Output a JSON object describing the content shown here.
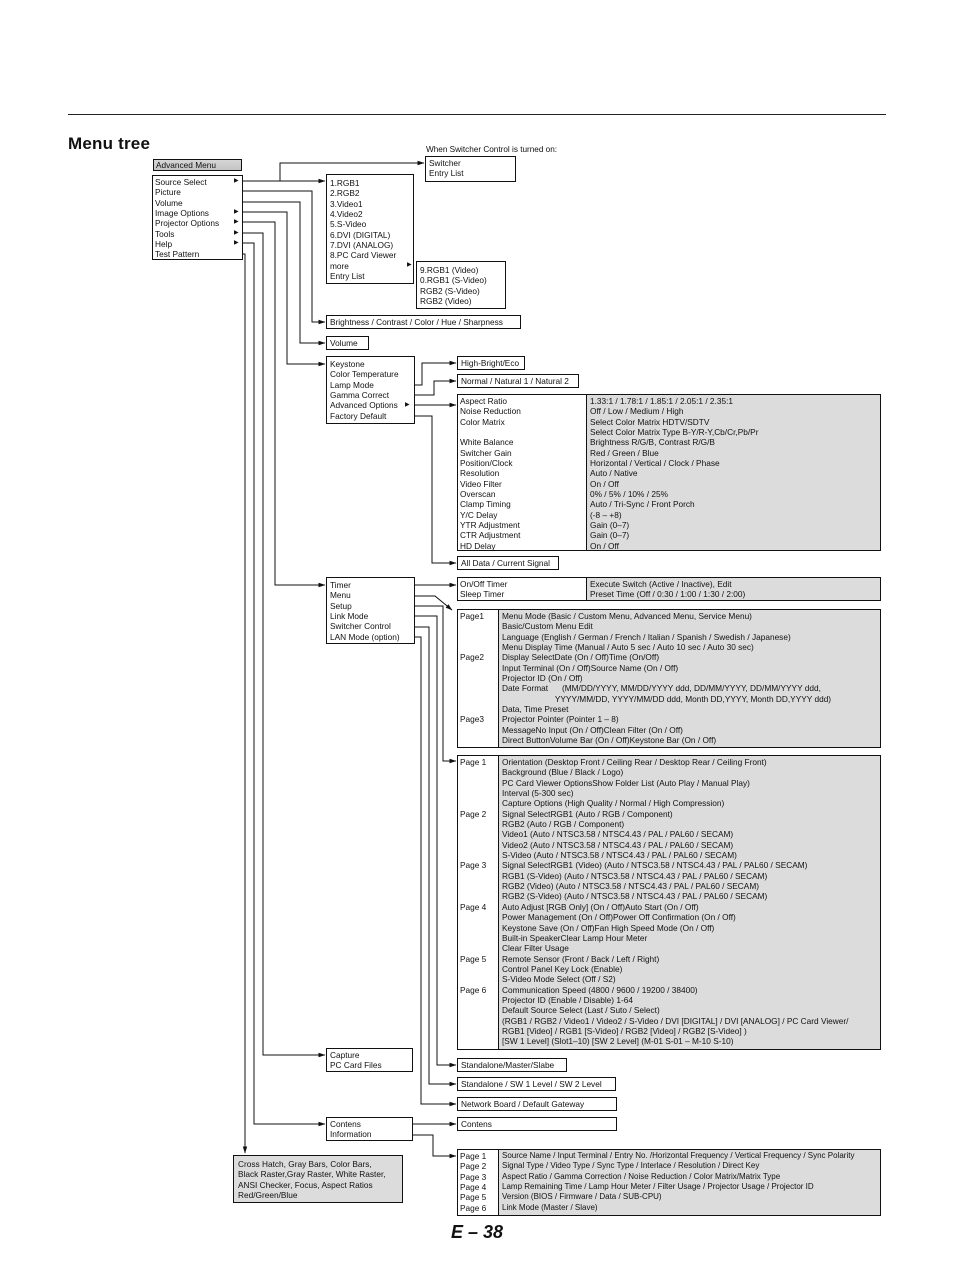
{
  "page": {
    "title": "Menu tree",
    "page_number": "E – 38"
  },
  "switcher_note": "When Switcher Control is turned on:",
  "switcher_box": [
    "Switcher",
    "Entry List"
  ],
  "advanced_menu": {
    "header": "Advanced Menu",
    "items": [
      {
        "label": "Source Select",
        "submenu": true
      },
      {
        "label": "Picture",
        "submenu": false
      },
      {
        "label": "Volume",
        "submenu": false
      },
      {
        "label": "Image Options",
        "submenu": true
      },
      {
        "label": "Projector Options",
        "submenu": true
      },
      {
        "label": "Tools",
        "submenu": true
      },
      {
        "label": "Help",
        "submenu": true
      },
      {
        "label": "Test Pattern",
        "submenu": false
      }
    ]
  },
  "source_select": [
    "1.RGB1",
    "2.RGB2",
    "3.Video1",
    "4.Video2",
    "5.S-Video",
    "6.DVI (DIGITAL)",
    "7.DVI (ANALOG)",
    "8.PC Card Viewer",
    "more",
    "Entry List"
  ],
  "source_more": [
    "9.RGB1 (Video)",
    "0.RGB1 (S-Video)",
    "RGB2 (S-Video)",
    "RGB2 (Video)"
  ],
  "picture": "Brightness / Contrast / Color / Hue / Sharpness",
  "volume": "Volume",
  "image_options": [
    "Keystone",
    "Color Temperature",
    "Lamp Mode",
    "Gamma Correct",
    "Advanced Options",
    "Factory Default"
  ],
  "lamp_mode": "High-Bright/Eco",
  "gamma_correct": "Normal / Natural 1 / Natural 2",
  "factory_default": "All Data / Current Signal",
  "advanced_options": [
    {
      "name": "Aspect Ratio",
      "value": "1.33:1 / 1.78:1 / 1.85:1 / 2.05:1 / 2.35:1"
    },
    {
      "name": "Noise Reduction",
      "value": "Off / Low / Medium / High"
    },
    {
      "name": "Color Matrix",
      "value": "Select Color Matrix HDTV/SDTV"
    },
    {
      "name": "",
      "value": "Select Color Matrix Type B-Y/R-Y,Cb/Cr,Pb/Pr"
    },
    {
      "name": "White Balance",
      "value": "Brightness R/G/B, Contrast R/G/B"
    },
    {
      "name": "Switcher Gain",
      "value": "Red / Green / Blue"
    },
    {
      "name": "Position/Clock",
      "value": "Horizontal / Vertical / Clock / Phase"
    },
    {
      "name": "Resolution",
      "value": "Auto / Native"
    },
    {
      "name": "Video Filter",
      "value": "On / Off"
    },
    {
      "name": "Overscan",
      "value": "0% / 5% / 10% / 25%"
    },
    {
      "name": "Clamp Timing",
      "value": "Auto / Tri-Sync / Front Porch"
    },
    {
      "name": "Y/C Delay",
      "value": "(-8 – +8)"
    },
    {
      "name": "YTR Adjustment",
      "value": "Gain (0–7)"
    },
    {
      "name": "CTR Adjustment",
      "value": "Gain (0–7)"
    },
    {
      "name": "HD Delay",
      "value": "On / Off"
    }
  ],
  "projector_options": [
    "Timer",
    "Menu",
    "Setup",
    "Link Mode",
    "Switcher Control",
    "LAN Mode (option)"
  ],
  "timer": [
    {
      "name": "On/Off Timer",
      "value": "Execute Switch (Active / Inactive), Edit"
    },
    {
      "name": "Sleep Timer",
      "value": "Preset Time (Off / 0:30 / 1:00 / 1:30 / 2:00)"
    }
  ],
  "menu_pages": {
    "labels": [
      "Page1",
      "",
      "",
      "",
      "Page2",
      "",
      "",
      "",
      "",
      "",
      "Page3",
      "",
      ""
    ],
    "lines": [
      "Menu Mode (Basic / Custom Menu, Advanced Menu, Service Menu)",
      "Basic/Custom Menu Edit",
      "Language (English / German / French / Italian / Spanish / Swedish / Japanese)",
      "Menu Display Time (Manual / Auto 5 sec / Auto 10 sec / Auto 30 sec)",
      [
        "Display Select",
        "Date (On / Off)",
        "Time (On/Off)"
      ],
      [
        "",
        "Input Terminal (On / Off)",
        "Source Name (On / Off)"
      ],
      [
        "",
        "Projector ID (On / Off)",
        ""
      ],
      "Date Format      (MM/DD/YYYY, MM/DD/YYYY ddd, DD/MM/YYYY, DD/MM/YYYY ddd,",
      "                       YYYY/MM/DD, YYYY/MM/DD ddd, Month DD,YYYY, Month DD,YYYY ddd)",
      "Data, Time Preset",
      "Projector Pointer (Pointer 1 – 8)",
      [
        "Message",
        "No Input (On / Off)",
        "Clean Filter (On / Off)"
      ],
      [
        "Direct Button",
        "Volume Bar (On / Off)",
        "Keystone Bar (On / Off)"
      ]
    ]
  },
  "setup_pages": {
    "labels": [
      "Page 1",
      "",
      "",
      "",
      "",
      "Page 2",
      "",
      "",
      "",
      "",
      "Page 3",
      "",
      "",
      "",
      "Page 4",
      "",
      "",
      "",
      "",
      "Page 5",
      "",
      "",
      "Page 6",
      "",
      "",
      "",
      "",
      ""
    ],
    "lines": [
      "Orientation (Desktop Front / Ceiling Rear / Desktop Rear / Ceiling Front)",
      "Background (Blue / Black / Logo)",
      [
        "PC Card Viewer Options",
        "Show Folder List (Auto Play / Manual Play)"
      ],
      [
        "",
        "Interval (5-300 sec)"
      ],
      "Capture Options (High Quality / Normal / High Compression)",
      [
        "Signal Select",
        "RGB1 (Auto / RGB / Component)"
      ],
      [
        "",
        "RGB2 (Auto / RGB / Component)"
      ],
      [
        "",
        "Video1 (Auto / NTSC3.58 / NTSC4.43 / PAL / PAL60 / SECAM)"
      ],
      [
        "",
        "Video2 (Auto / NTSC3.58 / NTSC4.43 / PAL / PAL60 / SECAM)"
      ],
      [
        "",
        "S-Video (Auto / NTSC3.58 / NTSC4.43 / PAL / PAL60 / SECAM)"
      ],
      [
        "Signal Select",
        "RGB1 (Video) (Auto / NTSC3.58 / NTSC4.43 / PAL / PAL60 / SECAM)"
      ],
      [
        "",
        "RGB1 (S-Video) (Auto / NTSC3.58 / NTSC4.43 / PAL / PAL60 / SECAM)"
      ],
      [
        "",
        "RGB2 (Video) (Auto / NTSC3.58 / NTSC4.43 / PAL / PAL60 / SECAM)"
      ],
      [
        "",
        "RGB2 (S-Video) (Auto / NTSC3.58 / NTSC4.43 / PAL / PAL60 / SECAM)"
      ],
      [
        "Auto Adjust [RGB Only] (On / Off)",
        "Auto Start (On / Off)"
      ],
      [
        "Power Management (On / Off)",
        "Power Off Confirmation (On / Off)"
      ],
      [
        "Keystone Save (On / Off)",
        "Fan High Speed Mode (On / Off)"
      ],
      [
        "Built-in Speaker",
        "Clear Lamp Hour Meter"
      ],
      "Clear Filter Usage",
      "Remote Sensor (Front / Back / Left / Right)",
      "Control Panel Key Lock (Enable)",
      "S-Video Mode Select (Off / S2)",
      "Communication Speed (4800 / 9600 / 19200 / 38400)",
      "Projector ID (Enable / Disable) 1-64",
      "Default Source Select (Last / Suto / Select)",
      "(RGB1 / RGB2 / Video1 / Video2 / S-Video / DVI [DIGITAL] / DVI [ANALOG] / PC Card Viewer/",
      "RGB1 [Video] / RGB1 [S-Video] / RGB2 [Video] / RGB2 [S-Video] )",
      "[SW 1 Level] (Slot1–10) [SW 2 Level] (M-01 S-01 – M-10 S-10)"
    ]
  },
  "link_mode": "Standalone/Master/Slabe",
  "switcher_control": "Standalone / SW 1 Level / SW 2 Level",
  "lan_mode": "Network Board / Default Gateway",
  "tools": [
    "Capture",
    "PC Card Files"
  ],
  "help": [
    "Contens",
    "Information"
  ],
  "contens": "Contens",
  "information": [
    {
      "page": "Page 1",
      "value": "Source Name / Input Terminal / Entry No. /Horizontal Frequency / Vertical Frequency / Sync Polarity"
    },
    {
      "page": "Page 2",
      "value": "Signal Type / Video Type / Sync Type / Interlace / Resolution / Direct Key"
    },
    {
      "page": "Page 3",
      "value": "Aspect Ratio / Gamma Correction / Noise Reduction / Color Matrix/Matrix Type"
    },
    {
      "page": "Page 4",
      "value": "Lamp Remaining Time / Lamp Hour Meter / Filter Usage / Projector Usage / Projector ID"
    },
    {
      "page": "Page 5",
      "value": "Version (BIOS / Firmware / Data / SUB-CPU)"
    },
    {
      "page": "Page 6",
      "value": "Link Mode (Master / Slave)"
    }
  ],
  "test_pattern": [
    "Cross Hatch, Gray Bars, Color Bars,",
    "Black Raster,Gray Raster, White Raster,",
    "ANSI Checker, Focus, Aspect Ratios",
    "Red/Green/Blue"
  ]
}
